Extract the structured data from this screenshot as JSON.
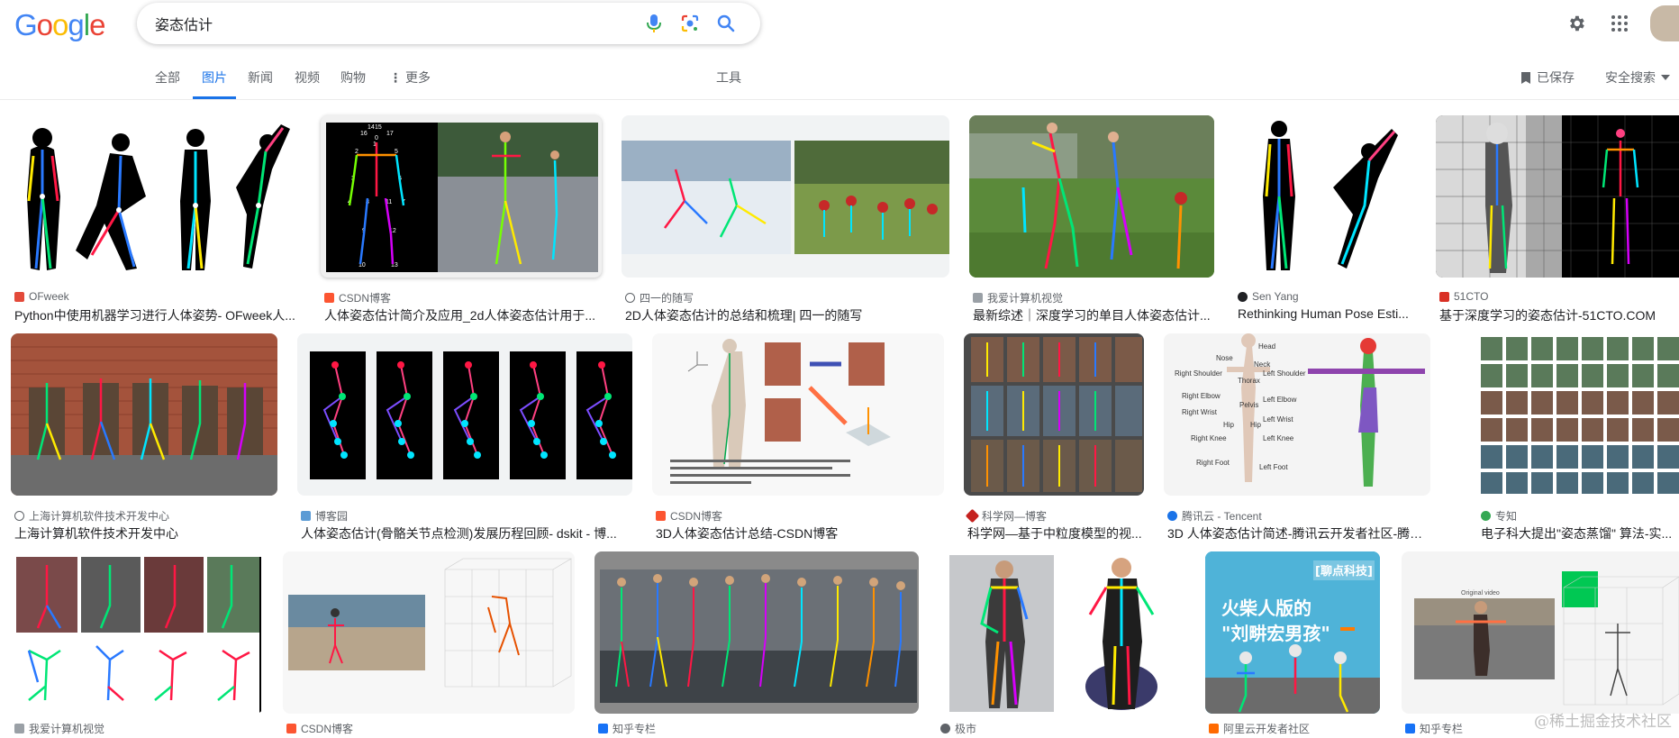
{
  "logo": {
    "text": "Google",
    "letters": [
      "G",
      "o",
      "o",
      "g",
      "l",
      "e"
    ],
    "colors": [
      "#4285f4",
      "#ea4335",
      "#fbbc05",
      "#4285f4",
      "#34a853",
      "#ea4335"
    ]
  },
  "search": {
    "query": "姿态估计",
    "icons": [
      "mic-icon",
      "lens-icon",
      "search-icon"
    ]
  },
  "header_right": {
    "icons": [
      "gear-icon",
      "apps-grid-icon"
    ]
  },
  "tabs": [
    {
      "label": "全部",
      "active": false
    },
    {
      "label": "图片",
      "active": true
    },
    {
      "label": "新闻",
      "active": false
    },
    {
      "label": "视频",
      "active": false
    },
    {
      "label": "购物",
      "active": false
    },
    {
      "label": "更多",
      "active": false
    }
  ],
  "toolbar": {
    "tools": "工具",
    "saved": "已保存",
    "safe_search": "安全搜索"
  },
  "accent": "#1a73e8",
  "results": [
    {
      "source": "OFweek",
      "title": "Python中使用机器学习进行人体姿势- OFweek人...",
      "favicon": "#e34a3a"
    },
    {
      "source": "CSDN博客",
      "title": "人体姿态估计简介及应用_2d人体姿态估计用于...",
      "favicon": "#fc5531"
    },
    {
      "source": "四一的随写",
      "title": "2D人体姿态估计的总结和梳理| 四一的随写",
      "favicon": "globe"
    },
    {
      "source": "我爱计算机视觉",
      "title": "最新综述｜深度学习的单目人体姿态估计...",
      "favicon": "#9aa0a6"
    },
    {
      "source": "Sen Yang",
      "title": "Rethinking Human Pose Esti...",
      "favicon": "#202124"
    },
    {
      "source": "51CTO",
      "title": "基于深度学习的姿态估计-51CTO.COM",
      "favicon": "#d93025"
    },
    {
      "source": "上海计算机软件技术开发中心",
      "title": "上海计算机软件技术开发中心",
      "favicon": "globe"
    },
    {
      "source": "博客园",
      "title": "人体姿态估计(骨骼关节点检测)发展历程回顾- dskit - 博...",
      "favicon": "#5b9bd5"
    },
    {
      "source": "CSDN博客",
      "title": "3D人体姿态估计总结-CSDN博客",
      "favicon": "#fc5531"
    },
    {
      "source": "科学网—博客",
      "title": "科学网—基于中粒度模型的视...",
      "favicon": "#c5221f"
    },
    {
      "source": "腾讯云 - Tencent",
      "title": "3D 人体姿态估计简述-腾讯云开发者社区-腾讯云",
      "favicon": "#1a73e8"
    },
    {
      "source": "专知",
      "title": "电子科大提出\"姿态蒸馏\" 算法-实...",
      "favicon": "#34a853"
    },
    {
      "source": "我爱计算机视觉",
      "title": "",
      "favicon": "#9aa0a6"
    },
    {
      "source": "CSDN博客",
      "title": "",
      "favicon": "#fc5531"
    },
    {
      "source": "知乎专栏",
      "title": "",
      "favicon": "#1772f6"
    },
    {
      "source": "极市",
      "title": "",
      "favicon": "#5f6368"
    },
    {
      "source": "阿里云开发者社区",
      "title": "",
      "favicon": "#ff6a00"
    },
    {
      "source": "知乎专栏",
      "title": "",
      "favicon": "#1772f6"
    }
  ],
  "image_texts": {
    "joint_labels": [
      "Head",
      "Neck",
      "Nose",
      "Right Shoulder",
      "Left Shoulder",
      "Right Elbow",
      "Left Elbow",
      "Right Wrist",
      "Left Wrist",
      "Right Knee",
      "Left Knee",
      "Right Foot",
      "Left Foot",
      "Thorax",
      "Pelvis",
      "Hip",
      "Hip"
    ],
    "keypoint_indices": [
      "14",
      "15",
      "16",
      "17",
      "0",
      "1",
      "2",
      "5",
      "3",
      "6",
      "4",
      "7",
      "8",
      "11",
      "9",
      "12",
      "10",
      "13"
    ],
    "banner_tag": "[聊点科技]",
    "banner_line1": "火柴人版的",
    "banner_line2": "\"刘畊宏男孩\"",
    "plot_label": "Original video"
  },
  "watermark": "@稀土掘金技术社区"
}
